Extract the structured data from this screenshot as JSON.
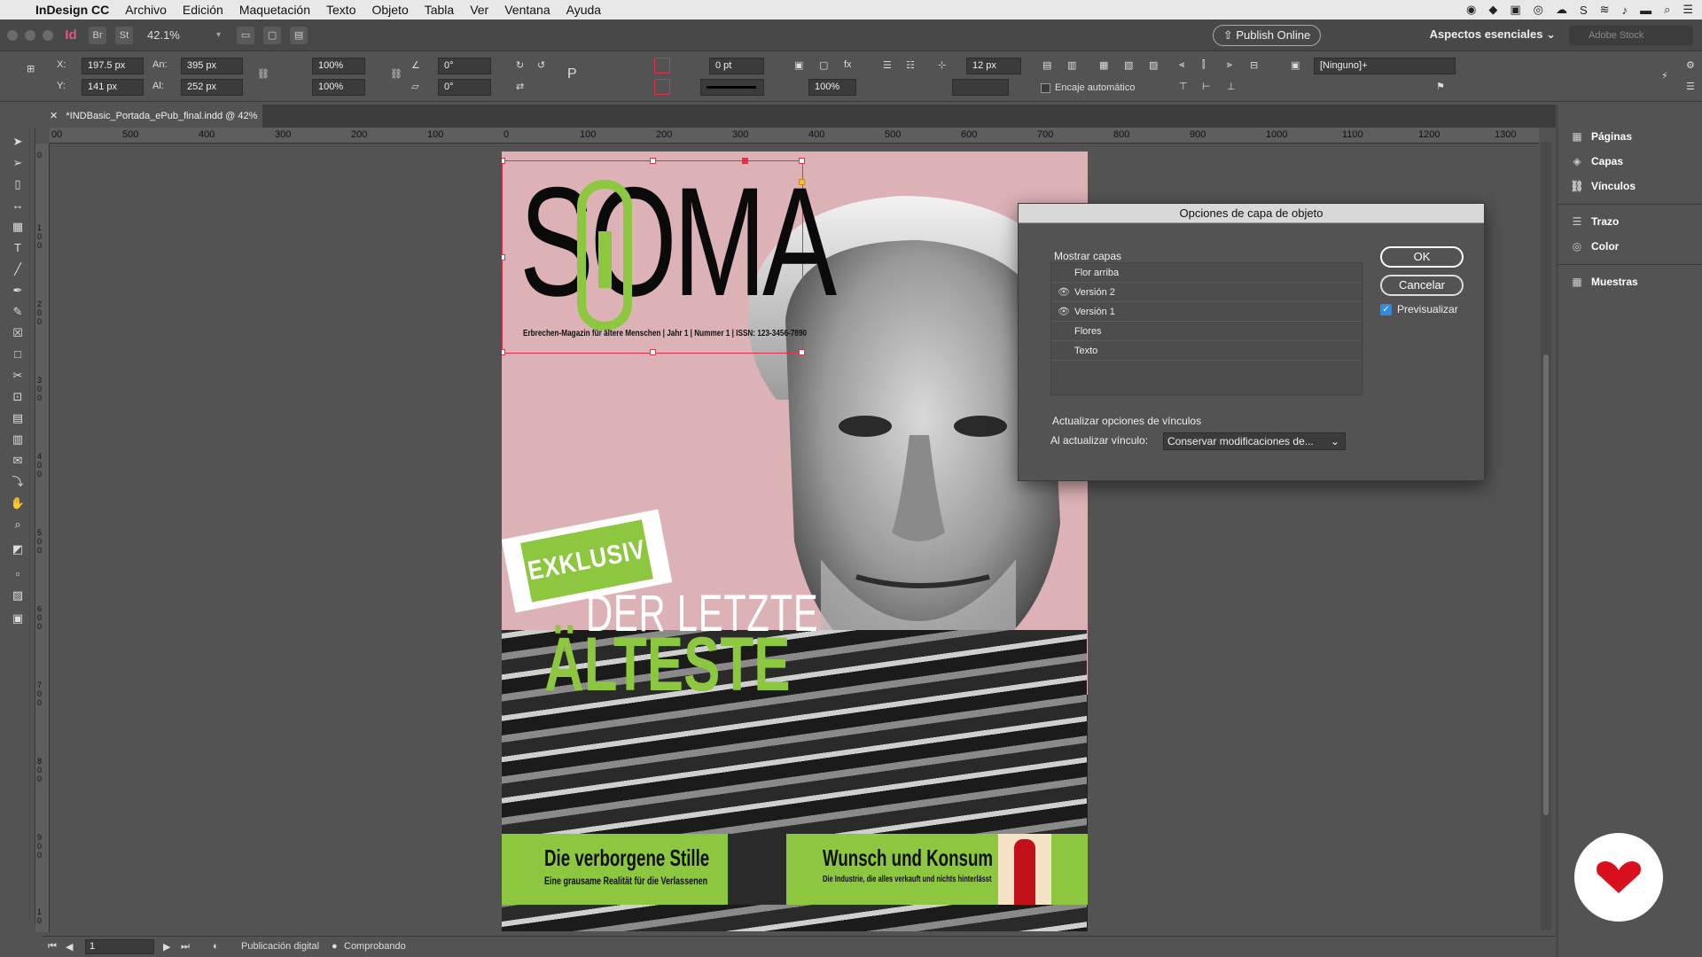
{
  "menubar": {
    "app_name": "InDesign CC",
    "items": [
      "Archivo",
      "Edición",
      "Maquetación",
      "Texto",
      "Objeto",
      "Tabla",
      "Ver",
      "Ventana",
      "Ayuda"
    ]
  },
  "appbar": {
    "zoom": "42.1%",
    "publish_label": "Publish Online",
    "workspace": "Aspectos esenciales",
    "stock_placeholder": "Adobe Stock",
    "br": "Br",
    "st": "St"
  },
  "control": {
    "x_label": "X:",
    "x_value": "197.5 px",
    "y_label": "Y:",
    "y_value": "141 px",
    "w_label": "An:",
    "w_value": "395 px",
    "h_label": "Al:",
    "h_value": "252 px",
    "scale_x": "100%",
    "scale_y": "100%",
    "angle": "0°",
    "shear": "0°",
    "stroke_weight": "0 pt",
    "opacity": "100%",
    "gap": "12 px",
    "fitting_label": "Encaje automático",
    "style": "[Ninguno]+"
  },
  "document_tab": {
    "title": "*INDBasic_Portada_ePub_final.indd @ 42%"
  },
  "ruler_h": [
    "00",
    "500",
    "400",
    "300",
    "200",
    "100",
    "0",
    "100",
    "200",
    "300",
    "400",
    "500",
    "600",
    "700",
    "800",
    "900",
    "1000",
    "1100",
    "1200",
    "1300"
  ],
  "ruler_v": [
    "0",
    "1 0 0",
    "2 0 0",
    "3 0 0",
    "4 0 0",
    "5 0 0",
    "6 0 0",
    "7 0 0",
    "8 0 0",
    "9 0 0",
    "1 0"
  ],
  "cover": {
    "title": "SOMA",
    "tagline": "Erbrechen-Magazin für ältere Menschen | Jahr 1 | Nummer 1 | ISSN: 123-3456-7890",
    "badge": "EXKLUSIV",
    "headline_top": "DER LETZTE",
    "headline_main": "ÄLTESTE",
    "story1_title": "Die verborgene Stille",
    "story1_sub": "Eine grausame Realität für die Verlassenen",
    "story2_title": "Wunsch und Konsum",
    "story2_sub": "Die Industrie, die alles verkauft und nichts hinterlässt"
  },
  "dialog": {
    "title": "Opciones de capa de objeto",
    "show_layers_label": "Mostrar capas",
    "layers": [
      {
        "name": "Flor arriba",
        "visible": false
      },
      {
        "name": "Versión 2",
        "visible": true
      },
      {
        "name": "Versión 1",
        "visible": true
      },
      {
        "name": "Flores",
        "visible": false
      },
      {
        "name": "Texto",
        "visible": false
      }
    ],
    "ok_label": "OK",
    "cancel_label": "Cancelar",
    "preview_label": "Previsualizar",
    "preview_checked": true,
    "update_section_label": "Actualizar opciones de vínculos",
    "update_field_label": "Al actualizar vínculo:",
    "update_value": "Conservar modificaciones de..."
  },
  "panels": [
    "Páginas",
    "Capas",
    "Vínculos",
    "Trazo",
    "Color",
    "Muestras"
  ],
  "status": {
    "page": "1",
    "mode": "Publicación digital",
    "preflight": "Comprobando"
  },
  "colors": {
    "accent_green": "#8dc63f",
    "page_pink": "#dcb2b6",
    "selection_red": "#e0324a"
  }
}
